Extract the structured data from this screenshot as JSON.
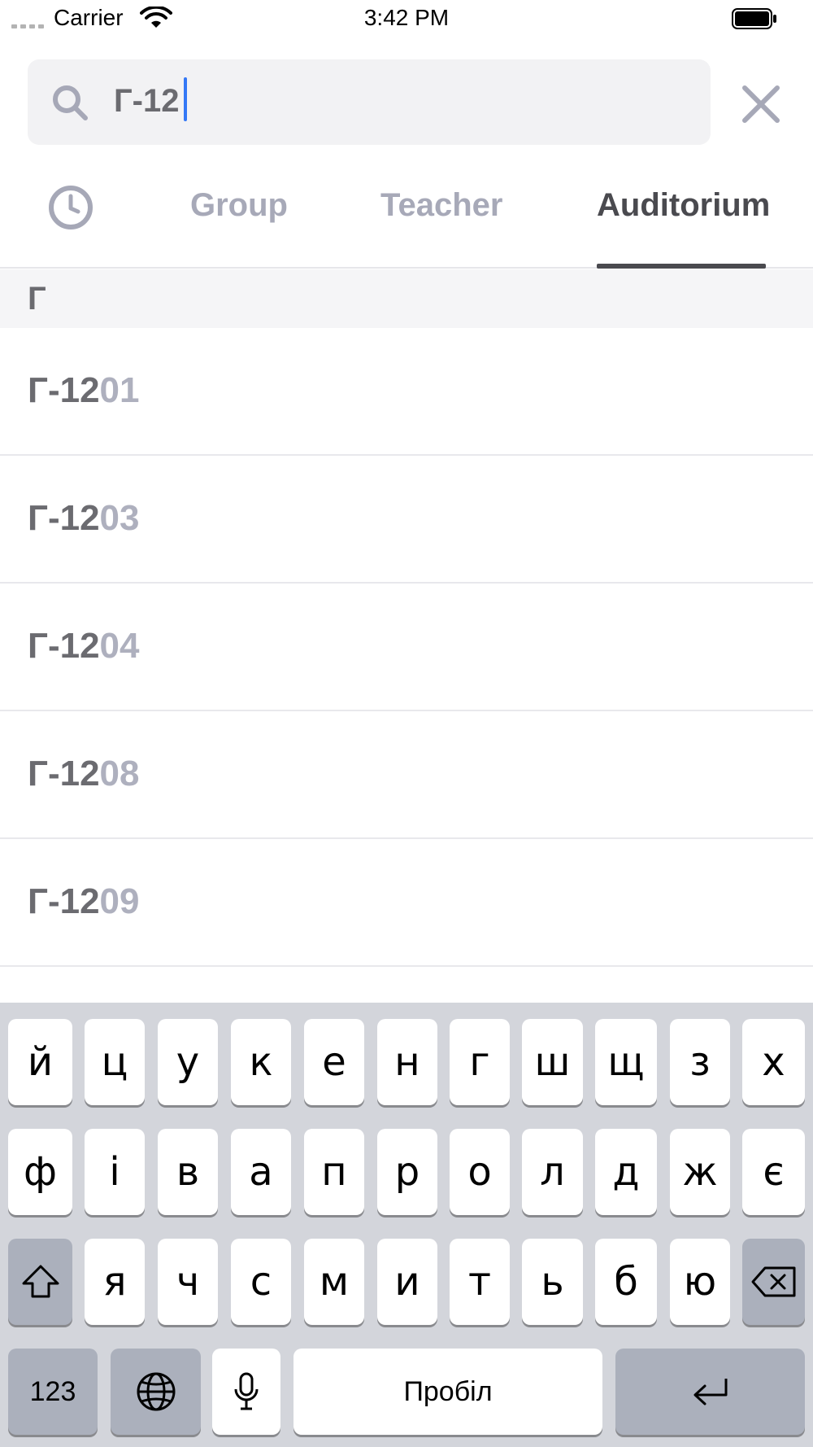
{
  "status_bar": {
    "carrier": "Carrier",
    "time": "3:42 PM"
  },
  "search": {
    "value": "Г-12",
    "placeholder": ""
  },
  "tabs": {
    "history_icon": "clock-icon",
    "items": [
      {
        "label": "Group",
        "active": false
      },
      {
        "label": "Teacher",
        "active": false
      },
      {
        "label": "Auditorium",
        "active": true
      }
    ]
  },
  "section": {
    "letter": "Г"
  },
  "results": [
    {
      "match": "Г-12",
      "rest": "01"
    },
    {
      "match": "Г-12",
      "rest": "03"
    },
    {
      "match": "Г-12",
      "rest": "04"
    },
    {
      "match": "Г-12",
      "rest": "08"
    },
    {
      "match": "Г-12",
      "rest": "09"
    }
  ],
  "keyboard": {
    "row1": [
      "й",
      "ц",
      "у",
      "к",
      "е",
      "н",
      "г",
      "ш",
      "щ",
      "з",
      "х"
    ],
    "row2": [
      "ф",
      "і",
      "в",
      "а",
      "п",
      "р",
      "о",
      "л",
      "д",
      "ж",
      "є"
    ],
    "row3": [
      "я",
      "ч",
      "с",
      "м",
      "и",
      "т",
      "ь",
      "б",
      "ю"
    ],
    "numbers_label": "123",
    "space_label": "Пробіл",
    "shift_icon": "shift-icon",
    "delete_icon": "delete-icon",
    "globe_icon": "globe-icon",
    "mic_icon": "microphone-icon",
    "return_icon": "return-icon"
  },
  "colors": {
    "accent_caret": "#3478f6",
    "active_tab": "#4a4a4f",
    "inactive_tab": "#a7a9b8"
  }
}
